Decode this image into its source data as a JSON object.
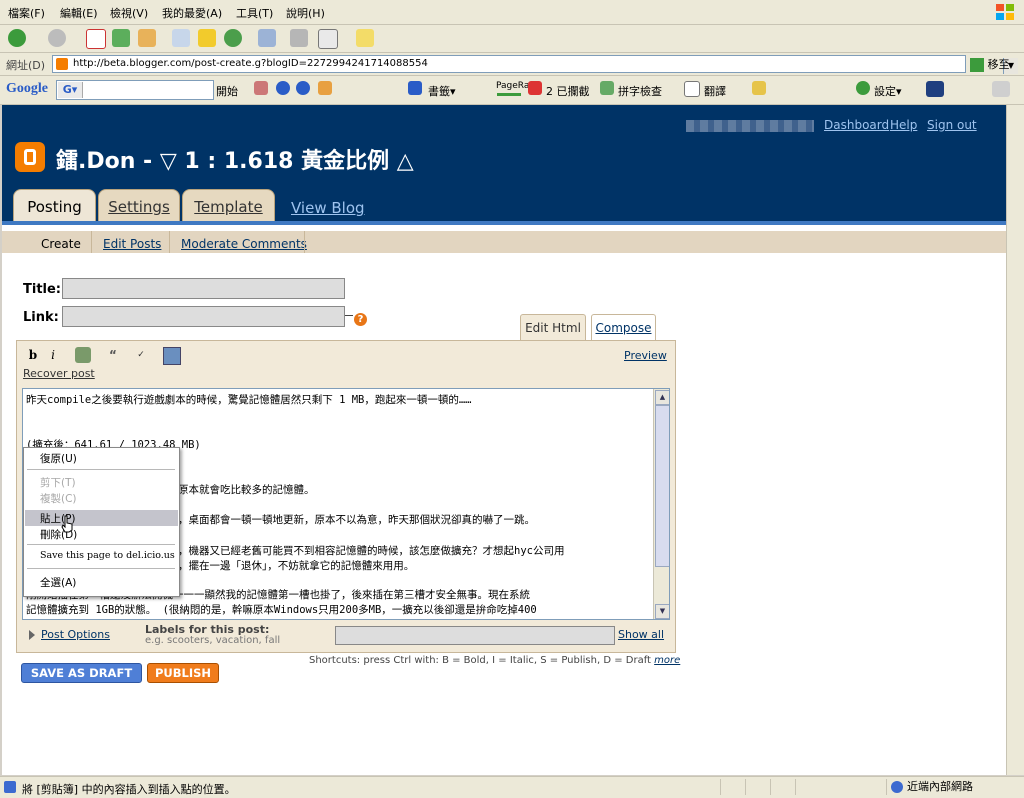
{
  "colors": {
    "header_bg": "#003366",
    "accent_orange": "#f57d00",
    "link": "#003366",
    "tab_bg": "#e6d9c0",
    "save_btn": "#4f7fd6",
    "publish_btn": "#f07c1c"
  },
  "menubar": {
    "items": [
      "檔案(F)",
      "編輯(E)",
      "檢視(V)",
      "我的最愛(A)",
      "工具(T)",
      "說明(H)"
    ]
  },
  "address": {
    "label": "網址(D)",
    "url": "http://beta.blogger.com/post-create.g?blogID=2272994241714088554",
    "go": "移至"
  },
  "google_bar": {
    "logo": "Google",
    "search_label": "開始",
    "bookmarks": "書籤▾",
    "pagerank": "PageRank",
    "blocked": "2 已攔截",
    "spellcheck": "拼字檢查",
    "translate": "翻譯",
    "settings": "設定▾"
  },
  "header": {
    "links": [
      "Dashboard",
      "Help",
      "Sign out"
    ],
    "blog_title": "鐳.Don - ▽ 1 : 1.618 黃金比例 △",
    "tabs": [
      "Posting",
      "Settings",
      "Template"
    ],
    "view_blog": "View Blog"
  },
  "subtabs": [
    "Create",
    "Edit Posts",
    "Moderate Comments"
  ],
  "form": {
    "title_label": "Title:",
    "link_label": "Link:",
    "help": "?"
  },
  "editor": {
    "tab_edit_html": "Edit Html",
    "tab_compose": "Compose",
    "preview": "Preview",
    "recover": "Recover post",
    "toolbar": {
      "bold": "b",
      "italic": "i"
    },
    "lines": [
      "昨天compile之後要執行遊戲劇本的時候，驚覺記憶體居然只剩下 1 MB，跑起來一頓一頓的……",
      "",
      "(擴充後：641.61 / 1023.48 MB)",
      "原本就會吃比較多的記憶體。",
      "，桌面都會一頓一頓地更新，原本不以為意，昨天那個狀況卻真的嚇了一跳。",
      "，機器又已經老舊可能買不到相容記憶體的時候，該怎麼做擴充？才想起hyc公司用",
      "，擺在一邊「退休」，不妨就拿它的記憶體來用用。",
      "剛開始插在第一槽還沒辦法開機一一一顯然我的記憶體第一槽也掛了，後來插在第三槽才安全無事。現在系統",
      "記憶體擴充到 1GB的狀態。 (很納悶的是，幹嘛原本Windows只用200多MB，一擴充以後卻還是拚命吃掉400"
    ]
  },
  "context_menu": {
    "items": [
      {
        "label": "復原(U)",
        "disabled": false
      },
      {
        "label": "剪下(T)",
        "disabled": true
      },
      {
        "label": "複製(C)",
        "disabled": true
      },
      {
        "label": "貼上(P)",
        "disabled": false,
        "highlighted": true
      },
      {
        "label": "刪除(D)",
        "disabled": false
      },
      {
        "label": "Save this page to del.icio.us",
        "disabled": false
      },
      {
        "label": "全選(A)",
        "disabled": false
      }
    ]
  },
  "post_footer": {
    "post_options": "Post Options",
    "labels_header": "Labels for this post:",
    "labels_hint": "e.g. scooters, vacation, fall",
    "show_all": "Show all",
    "shortcuts": "Shortcuts: press Ctrl with: B = Bold, I = Italic, S = Publish, D = Draft",
    "shortcuts_more": "more"
  },
  "buttons": {
    "save_draft": "SAVE AS DRAFT",
    "publish": "PUBLISH"
  },
  "statusbar": {
    "text": "將 [剪貼簿] 中的內容插入到插入點的位置。",
    "zone": "近端內部網路"
  }
}
